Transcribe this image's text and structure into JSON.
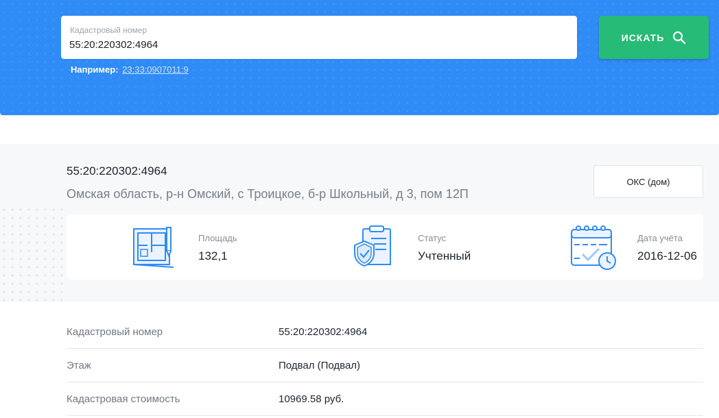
{
  "search": {
    "label": "Кадастровый номер",
    "value": "55:20:220302:4964",
    "example_prefix": "Например:",
    "example_link": "23:33:0907011:9",
    "button_label": "ИСКАТЬ"
  },
  "object": {
    "number": "55:20:220302:4964",
    "address": "Омская область, р-н Омский, с Троицкое, б-р Школьный, д 3, пом 12П",
    "type_label": "ОКС (дом)"
  },
  "stats": [
    {
      "label": "Площадь",
      "value": "132,1",
      "icon": "floor-plan-icon"
    },
    {
      "label": "Статус",
      "value": "Учтенный",
      "icon": "document-shield-icon"
    },
    {
      "label": "Дата учёта",
      "value": "2016-12-06",
      "icon": "calendar-clock-icon"
    }
  ],
  "details": [
    {
      "key": "Кадастровый номер",
      "value": "55:20:220302:4964"
    },
    {
      "key": "Этаж",
      "value": "Подвал (Подвал)"
    },
    {
      "key": "Кадастровая стоимость",
      "value": "10969.58 руб."
    }
  ],
  "colors": {
    "hero": "#2f8bf5",
    "button": "#26bb77",
    "icon": "#2f8bf5"
  }
}
